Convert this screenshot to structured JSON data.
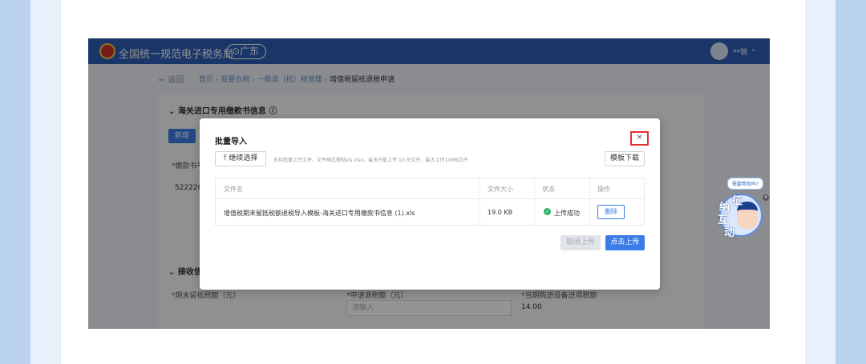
{
  "app": {
    "title": "全国统一规范电子税务局",
    "region": "⊙广东",
    "user": "**锐",
    "user_caret": "⌄",
    "back": "← 返回",
    "breadcrumbs": [
      "首页",
      "›",
      "我要办税",
      "›",
      "一般退（抵）税管理",
      "›",
      "增值税留抵退税申请"
    ]
  },
  "background": {
    "section1_title": "⌄ 海关进口专用缴款书信息 ⓘ",
    "new_button": "新增",
    "field_label_1": "*缴款书号",
    "field_value_1": "522220",
    "section2_title": "⌄ 接收信",
    "label_a": "*期末留抵税额（元）",
    "label_b": "*申请退税额（元）",
    "label_c": "*当期购进设备进项税额",
    "input_b_placeholder": "请输入",
    "value_c": "14.00"
  },
  "mascot": {
    "bubble": "需要帮助吗?",
    "chars": [
      "征",
      "纳",
      "互",
      "动"
    ],
    "close": "×"
  },
  "modal": {
    "title": "批量导入",
    "close": "×",
    "continue_button": "⤒ 继续选择",
    "hint": "支持批量上传文件，文件格式需制xls xlsx，最多只能上传 10 份文件，最大上传10MB文件",
    "template_button": "模板下载",
    "columns": [
      "文件名",
      "文件大小",
      "状态",
      "操作"
    ],
    "rows": [
      {
        "filename": "增值税期末留抵税额退税导入模板-海关进口专用缴款书信息 (1).xls",
        "size": "19.0 KB",
        "status": "上传成功",
        "status_icon": "✓",
        "action": "删除"
      }
    ],
    "cancel_upload": "取消上传",
    "upload": "点击上传"
  },
  "colors": {
    "primary": "#3b7be6",
    "header": "#2d5db6",
    "success": "#2fb36a",
    "highlight": "#e23131"
  }
}
